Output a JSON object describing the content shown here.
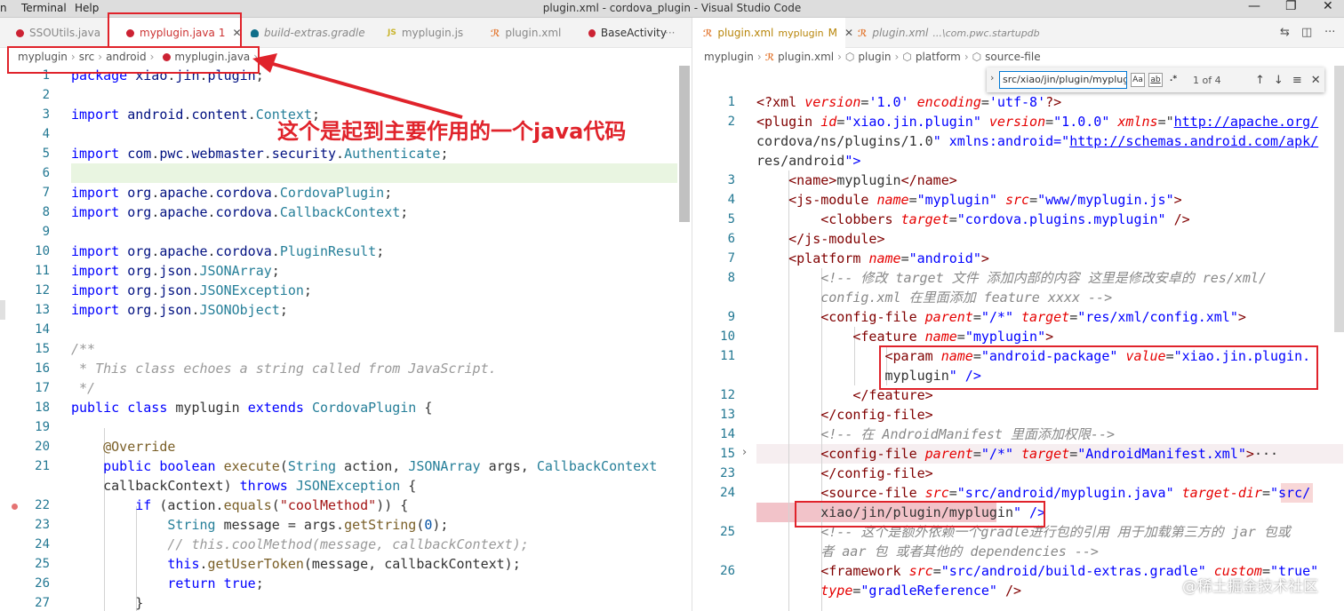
{
  "window": {
    "menu_terminal": "Terminal",
    "menu_help": "Help",
    "title": "plugin.xml - cordova_plugin - Visual Studio Code"
  },
  "left_tabs": [
    {
      "label": "SSOUtils.java",
      "icon": "java-icon"
    },
    {
      "label": "myplugin.java",
      "badge": "1",
      "icon": "java-icon"
    },
    {
      "label": "build-extras.gradle",
      "icon": "gradle-icon"
    },
    {
      "label": "myplugin.js",
      "icon": "js-icon"
    },
    {
      "label": "plugin.xml",
      "icon": "xml-icon"
    },
    {
      "label": "BaseActivity",
      "icon": "java-icon"
    }
  ],
  "left_tabs_more": "···",
  "left_breadcrumb": [
    "myplugin",
    "src",
    "android",
    "myplugin.java",
    "..."
  ],
  "right_tabs": [
    {
      "label": "plugin.xml",
      "sub": "myplugin",
      "modified": "M"
    },
    {
      "label": "plugin.xml",
      "sub": "...\\com.pwc.startupdb"
    }
  ],
  "right_breadcrumb": [
    "myplugin",
    "plugin.xml",
    "plugin",
    "platform",
    "source-file"
  ],
  "find": {
    "value": "src/xiao/jin/plugin/myplugin",
    "case": "Aa",
    "word": "ab",
    "regex": ".*",
    "count": "1 of 4"
  },
  "annotation": "这个是起到主要作用的一个java代码",
  "watermark": "@稀土掘金技术社区",
  "left_line_numbers": [
    "1",
    "2",
    "3",
    "4",
    "5",
    "6",
    "7",
    "8",
    "9",
    "10",
    "11",
    "12",
    "13",
    "14",
    "15",
    "16",
    "17",
    "18",
    "19",
    "20",
    "21",
    "",
    "22",
    "23",
    "24",
    "25",
    "26",
    "27"
  ],
  "left_code": [
    "package xiao.jin.plugin;",
    "",
    "import android.content.Context;",
    "",
    "import com.pwc.webmaster.security.Authenticate;",
    "",
    "import org.apache.cordova.CordovaPlugin;",
    "import org.apache.cordova.CallbackContext;",
    "",
    "import org.apache.cordova.PluginResult;",
    "import org.json.JSONArray;",
    "import org.json.JSONException;",
    "import org.json.JSONObject;",
    "",
    "/**",
    " * This class echoes a string called from JavaScript.",
    " */",
    "public class myplugin extends CordovaPlugin {",
    "",
    "    @Override",
    "    public boolean execute(String action, JSONArray args, CallbackContext",
    "    callbackContext) throws JSONException {",
    "        if (action.equals(\"coolMethod\")) {",
    "            String message = args.getString(0);",
    "            // this.coolMethod(message, callbackContext);",
    "            this.getUserToken(message, callbackContext);",
    "            return true;",
    "        }"
  ],
  "right_line_numbers": [
    "1",
    "2",
    "",
    "",
    "3",
    "4",
    "5",
    "6",
    "7",
    "8",
    "",
    "9",
    "10",
    "11",
    "",
    "12",
    "13",
    "14",
    "15",
    "23",
    "24",
    "",
    "25",
    "",
    "26",
    ""
  ],
  "right_code": [
    "<?xml version='1.0' encoding='utf-8'?>",
    "<plugin id=\"xiao.jin.plugin\" version=\"1.0.0\" xmlns=\"http://apache.org/",
    "cordova/ns/plugins/1.0\" xmlns:android=\"http://schemas.android.com/apk/",
    "res/android\">",
    "    <name>myplugin</name>",
    "    <js-module name=\"myplugin\" src=\"www/myplugin.js\">",
    "        <clobbers target=\"cordova.plugins.myplugin\" />",
    "    </js-module>",
    "    <platform name=\"android\">",
    "        <!-- 修改 target 文件 添加内部的内容 这里是修改安卓的 res/xml/",
    "        config.xml 在里面添加 feature xxxx -->",
    "        <config-file parent=\"/*\" target=\"res/xml/config.xml\">",
    "            <feature name=\"myplugin\">",
    "                <param name=\"android-package\" value=\"xiao.jin.plugin.",
    "                myplugin\" />",
    "            </feature>",
    "        </config-file>",
    "        <!-- 在 AndroidManifest 里面添加权限-->",
    "        <config-file parent=\"/*\" target=\"AndroidManifest.xml\">···",
    "        </config-file>",
    "        <source-file src=\"src/android/myplugin.java\" target-dir=\"src/",
    "        xiao/jin/plugin/myplugin\" />",
    "        <!-- 这个是额外依赖一个gradle进行包的引用 用于加载第三方的 jar 包或",
    "        者 aar 包 或者其他的 dependencies -->",
    "        <framework src=\"src/android/build-extras.gradle\" custom=\"true\"",
    "        type=\"gradleReference\" />"
  ]
}
